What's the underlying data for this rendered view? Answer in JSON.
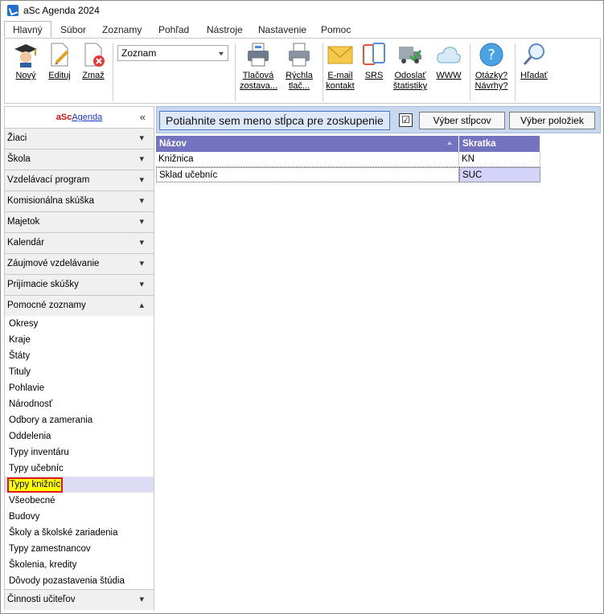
{
  "window": {
    "title": "aSc Agenda 2024"
  },
  "tabs": [
    "Hlavný",
    "Súbor",
    "Zoznamy",
    "Pohľad",
    "Nástroje",
    "Nastavenie",
    "Pomoc"
  ],
  "ribbon": {
    "new": "Nový",
    "edit": "Edituj",
    "delete": "Zmaž",
    "combo_value": "Zoznam",
    "print_set_1": "Tlačová",
    "print_set_2": "zostava...",
    "quick_print_1": "Rýchla",
    "quick_print_2": "tlač...",
    "email_1": "E-mail",
    "email_2": "kontakt",
    "srs": "SRS",
    "stats_1": "Odoslať",
    "stats_2": "štatistiky",
    "www": "WWW",
    "questions_1": "Otázky?",
    "questions_2": "Návrhy?",
    "search": "Hľadať"
  },
  "sidebar": {
    "brand_a": "aSc",
    "brand_b": "Agenda",
    "collapse_glyph": "«",
    "sections_top": [
      "Žiaci",
      "Škola",
      "Vzdelávací program",
      "Komisionálna skúška",
      "Majetok",
      "Kalendár",
      "Záujmové vzdelávanie",
      "Prijímacie skúšky"
    ],
    "open_section": "Pomocné zoznamy",
    "items": [
      "Okresy",
      "Kraje",
      "Štáty",
      "Tituly",
      "Pohlavie",
      "Národnosť",
      "Odbory a zamerania",
      "Oddelenia",
      "Typy inventáru",
      "Typy učebníc",
      "Typy knižníc",
      "Všeobecné",
      "Budovy",
      "Školy a školské zariadenia",
      "Typy zamestnancov",
      "Školenia, kredity",
      "Dôvody pozastavenia štúdia"
    ],
    "selected_item": "Typy knižníc",
    "bottom_section": "Činnosti učiteľov"
  },
  "toolbar": {
    "group_hint": "Potiahnite sem meno stĺpca pre zoskupenie",
    "check_glyph": "☑",
    "columns_button": "Výber stĺpcov",
    "items_button": "Výber položiek"
  },
  "table": {
    "headers": [
      "Názov",
      "Skratka"
    ],
    "rows": [
      {
        "name": "Knižnica",
        "abbr": "KN"
      },
      {
        "name": "Sklad učebníc",
        "abbr": "SUC"
      }
    ]
  }
}
